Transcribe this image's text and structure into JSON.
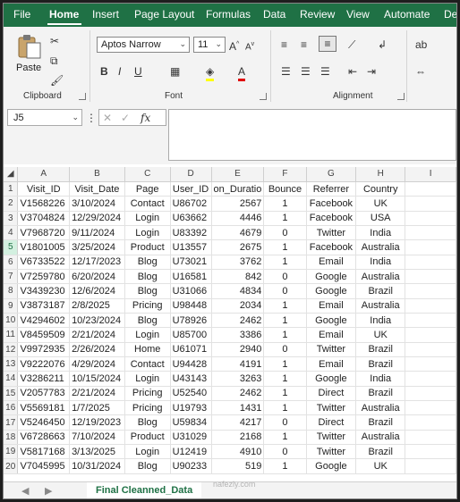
{
  "menu": {
    "tabs": [
      "File",
      "Home",
      "Insert",
      "Page Layout",
      "Formulas",
      "Data",
      "Review",
      "View",
      "Automate",
      "Dev"
    ]
  },
  "ribbon": {
    "paste_label": "Paste",
    "font_name": "Aptos Narrow",
    "font_size": "11",
    "groups": {
      "clipboard": "Clipboard",
      "font": "Font",
      "alignment": "Alignment"
    }
  },
  "formula_bar": {
    "name_box": "J5",
    "fx": "fx",
    "value": ""
  },
  "sheet": {
    "columns": [
      "A",
      "B",
      "C",
      "D",
      "E",
      "F",
      "G",
      "H",
      "I"
    ],
    "header": [
      "Visit_ID",
      "Visit_Date",
      "Page",
      "User_ID",
      "on_Duratio",
      "Bounce",
      "Referrer",
      "Country"
    ],
    "rows": [
      [
        "V1568226",
        "3/10/2024",
        "Contact",
        "U86702",
        "2567",
        "1",
        "Facebook",
        "UK"
      ],
      [
        "V3704824",
        "12/29/2024",
        "Login",
        "U63662",
        "4446",
        "1",
        "Facebook",
        "USA"
      ],
      [
        "V7968720",
        "9/11/2024",
        "Login",
        "U83392",
        "4679",
        "0",
        "Twitter",
        "India"
      ],
      [
        "V1801005",
        "3/25/2024",
        "Product",
        "U13557",
        "2675",
        "1",
        "Facebook",
        "Australia"
      ],
      [
        "V6733522",
        "12/17/2023",
        "Blog",
        "U73021",
        "3762",
        "1",
        "Email",
        "India"
      ],
      [
        "V7259780",
        "6/20/2024",
        "Blog",
        "U16581",
        "842",
        "0",
        "Google",
        "Australia"
      ],
      [
        "V3439230",
        "12/6/2024",
        "Blog",
        "U31066",
        "4834",
        "0",
        "Google",
        "Brazil"
      ],
      [
        "V3873187",
        "2/8/2025",
        "Pricing",
        "U98448",
        "2034",
        "1",
        "Email",
        "Australia"
      ],
      [
        "V4294602",
        "10/23/2024",
        "Blog",
        "U78926",
        "2462",
        "1",
        "Google",
        "India"
      ],
      [
        "V8459509",
        "2/21/2024",
        "Login",
        "U85700",
        "3386",
        "1",
        "Email",
        "UK"
      ],
      [
        "V9972935",
        "2/26/2024",
        "Home",
        "U61071",
        "2940",
        "0",
        "Twitter",
        "Brazil"
      ],
      [
        "V9222076",
        "4/29/2024",
        "Contact",
        "U94428",
        "4191",
        "1",
        "Email",
        "Brazil"
      ],
      [
        "V3286211",
        "10/15/2024",
        "Login",
        "U43143",
        "3263",
        "1",
        "Google",
        "India"
      ],
      [
        "V2057783",
        "2/21/2024",
        "Pricing",
        "U52540",
        "2462",
        "1",
        "Direct",
        "Brazil"
      ],
      [
        "V5569181",
        "1/7/2025",
        "Pricing",
        "U19793",
        "1431",
        "1",
        "Twitter",
        "Australia"
      ],
      [
        "V5246450",
        "12/19/2023",
        "Blog",
        "U59834",
        "4217",
        "0",
        "Direct",
        "Brazil"
      ],
      [
        "V6728663",
        "7/10/2024",
        "Product",
        "U31029",
        "2168",
        "1",
        "Twitter",
        "Australia"
      ],
      [
        "V5817168",
        "3/13/2025",
        "Login",
        "U12419",
        "4910",
        "0",
        "Twitter",
        "Brazil"
      ],
      [
        "V7045995",
        "10/31/2024",
        "Blog",
        "U90233",
        "519",
        "1",
        "Google",
        "UK"
      ]
    ]
  },
  "tabs_bar": {
    "sheet_name": "Final Cleanned_Data",
    "watermark": "nafezly.com"
  },
  "colors": {
    "brand": "#1f7145",
    "ribbon_bg": "#f3f3f3"
  }
}
